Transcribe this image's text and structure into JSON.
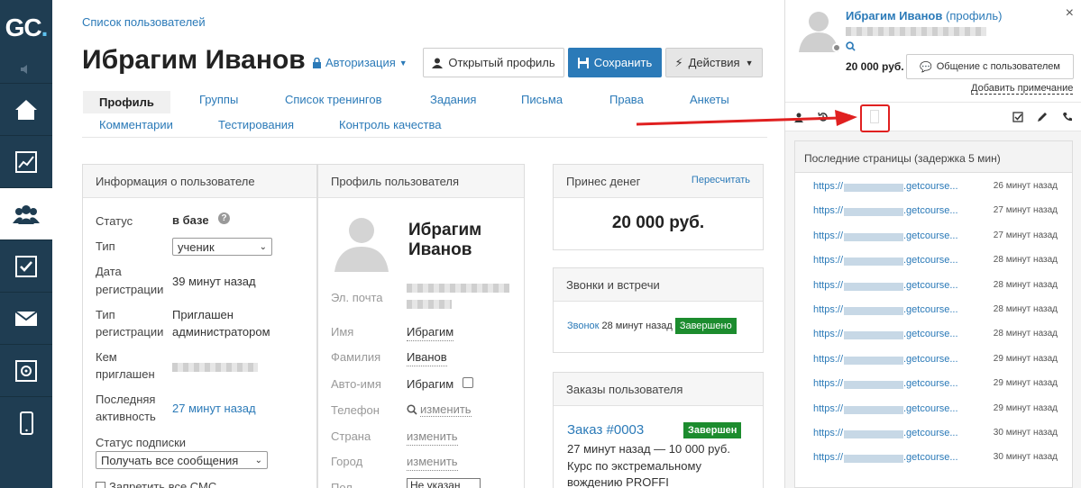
{
  "logo": {
    "g": "G",
    "c": "C",
    "dot": "."
  },
  "nav": {
    "items": [
      {
        "name": "home-icon"
      },
      {
        "name": "chart-icon"
      },
      {
        "name": "users-icon"
      },
      {
        "name": "tasks-icon"
      },
      {
        "name": "mail-icon"
      },
      {
        "name": "safe-icon"
      },
      {
        "name": "mobile-icon"
      }
    ]
  },
  "breadcrumb": "Список пользователей",
  "page_title": "Ибрагим Иванов",
  "auth_link": "Авторизация",
  "buttons": {
    "open_profile": "Открытый профиль",
    "save": "Сохранить",
    "actions": "Действия"
  },
  "tabs_row1": [
    "Профиль",
    "Группы",
    "Список тренингов",
    "Задания",
    "Письма",
    "Права",
    "Анкеты"
  ],
  "tabs_row2": [
    "Комментарии",
    "Тестирования",
    "Контроль качества"
  ],
  "info_panel": {
    "title": "Информация о пользователе",
    "status_label": "Статус",
    "status_value": "в базе",
    "type_label": "Тип",
    "type_value": "ученик",
    "reg_date_label_1": "Дата",
    "reg_date_label_2": "регистрации",
    "reg_date_value": "39 минут назад",
    "reg_type_label_1": "Тип",
    "reg_type_label_2": "регистрации",
    "reg_type_value_1": "Приглашен",
    "reg_type_value_2": "администратором",
    "invited_label_1": "Кем",
    "invited_label_2": "приглашен",
    "last_active_label_1": "Последняя",
    "last_active_label_2": "активность",
    "last_active_value": "27 минут назад",
    "sub_status_label": "Статус подписки",
    "sub_status_value": "Получать все сообщения",
    "sms_label": "Запретить все СМС"
  },
  "profile_panel": {
    "title": "Профиль пользователя",
    "name_line1": "Ибрагим",
    "name_line2": "Иванов",
    "email_label": "Эл. почта",
    "first_name_label": "Имя",
    "first_name_value": "Ибрагим",
    "last_name_label": "Фамилия",
    "last_name_value": "Иванов",
    "auto_name_label": "Авто-имя",
    "auto_name_value": "Ибрагим",
    "phone_label": "Телефон",
    "phone_value": "изменить",
    "country_label": "Страна",
    "country_value": "изменить",
    "city_label": "Город",
    "city_value": "изменить",
    "gender_label": "Пол",
    "gender_value": "Не указан"
  },
  "money_panel": {
    "title": "Принес денег",
    "recalc": "Пересчитать",
    "amount": "20 000 руб."
  },
  "calls_panel": {
    "title": "Звонки и встречи",
    "call_link": "Звонок",
    "call_time": "28 минут назад",
    "call_status": "Завершено"
  },
  "orders_panel": {
    "title": "Заказы пользователя",
    "order_link": "Заказ #0003",
    "order_status": "Завершен",
    "order_meta": "27 минут назад — 10 000 руб.",
    "order_desc_1": "Курс по экстремальному",
    "order_desc_2": "вождению PROFFI"
  },
  "right_panel": {
    "user_name": "Ибрагим Иванов",
    "profile_link": "(профиль)",
    "amount": "20 000 руб.",
    "chat_button": "Общение с пользователем",
    "add_note": "Добавить примечание",
    "recent_title": "Последние страницы (задержка 5 мин)",
    "rows": [
      {
        "url": "https://",
        "domain": ".getcourse...",
        "time": "26 минут назад"
      },
      {
        "url": "https://",
        "domain": ".getcourse...",
        "time": "27 минут назад"
      },
      {
        "url": "https://",
        "domain": ".getcourse...",
        "time": "27 минут назад"
      },
      {
        "url": "https://",
        "domain": ".getcourse...",
        "time": "28 минут назад"
      },
      {
        "url": "https://",
        "domain": ".getcourse...",
        "time": "28 минут назад"
      },
      {
        "url": "https://",
        "domain": ".getcourse...",
        "time": "28 минут назад"
      },
      {
        "url": "https://",
        "domain": ".getcourse...",
        "time": "28 минут назад"
      },
      {
        "url": "https://",
        "domain": ".getcourse...",
        "time": "29 минут назад"
      },
      {
        "url": "https://",
        "domain": ".getcourse...",
        "time": "29 минут назад"
      },
      {
        "url": "https://",
        "domain": ".getcourse...",
        "time": "29 минут назад"
      },
      {
        "url": "https://",
        "domain": ".getcourse...",
        "time": "30 минут назад"
      },
      {
        "url": "https://",
        "domain": ".getcourse...",
        "time": "30 минут назад"
      }
    ]
  },
  "colors": {
    "accent": "#2b7ab8",
    "nav_bg": "#1f3d52",
    "success": "#1c8c2e",
    "annotation": "#e02020"
  }
}
